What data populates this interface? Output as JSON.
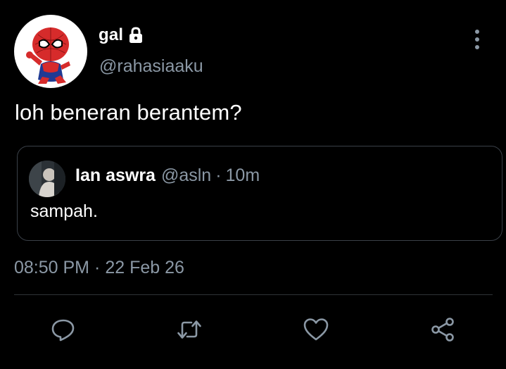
{
  "author": {
    "display_name": "gal",
    "handle": "@rahasiaaku",
    "avatar_icon": "spiderman-avatar",
    "protected_icon": "lock-icon"
  },
  "tweet": {
    "text": "loh beneran berantem?",
    "timestamp_time": "08:50 PM",
    "timestamp_sep": "·",
    "timestamp_date": "22 Feb 26"
  },
  "quoted": {
    "name": "Ian aswra",
    "handle": "@asln",
    "sep": "·",
    "time": "10m",
    "text": "sampah."
  },
  "actions": {
    "reply_icon": "reply-icon",
    "retweet_icon": "retweet-icon",
    "like_icon": "heart-icon",
    "share_icon": "share-icon"
  },
  "colors": {
    "background": "#000000",
    "primary_text": "#ffffff",
    "secondary_text": "#8b98a5",
    "border": "#3a4048"
  }
}
